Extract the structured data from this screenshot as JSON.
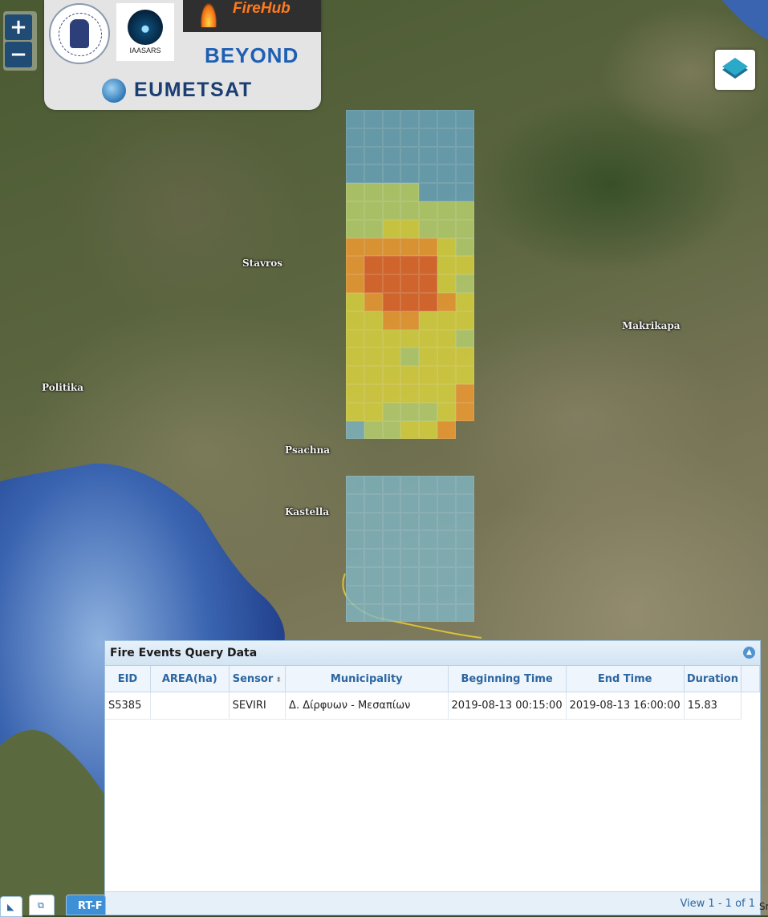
{
  "map": {
    "places": [
      {
        "name": "Stavros"
      },
      {
        "name": "Makrikapa"
      },
      {
        "name": "Politika"
      },
      {
        "name": "Psachna"
      },
      {
        "name": "Kastella"
      }
    ],
    "fire_grid_colors": {
      "blue": "#6aa9c6",
      "blue_light": "#7fb8c8",
      "green": "#b7cf6e",
      "yellow": "#d9d23f",
      "orange": "#ee9a32",
      "red": "#e4642a"
    }
  },
  "controls": {
    "zoom_in": "+",
    "zoom_out": "−",
    "layers_icon": "layers-icon"
  },
  "logos": {
    "iaasars": "IAASARS",
    "firehub": "FireHub",
    "beyond": "BEYOND",
    "eumetsat": "EUMETSAT"
  },
  "panel": {
    "title": "Fire Events Query Data",
    "columns": [
      "EID",
      "AREA(ha)",
      "Sensor",
      "Municipality",
      "Beginning Time",
      "End Time",
      "Duration"
    ],
    "rows": [
      [
        "S5385",
        "",
        "SEVIRI",
        "Δ. Δίρφυων - Μεσαπίων",
        "2019-08-13 00:15:00",
        "2019-08-13 16:00:00",
        "15.83"
      ]
    ],
    "pager": "View 1 - 1 of 1"
  },
  "taskbar": {
    "tab_label": "RT-F",
    "edge_text": "Sr"
  }
}
